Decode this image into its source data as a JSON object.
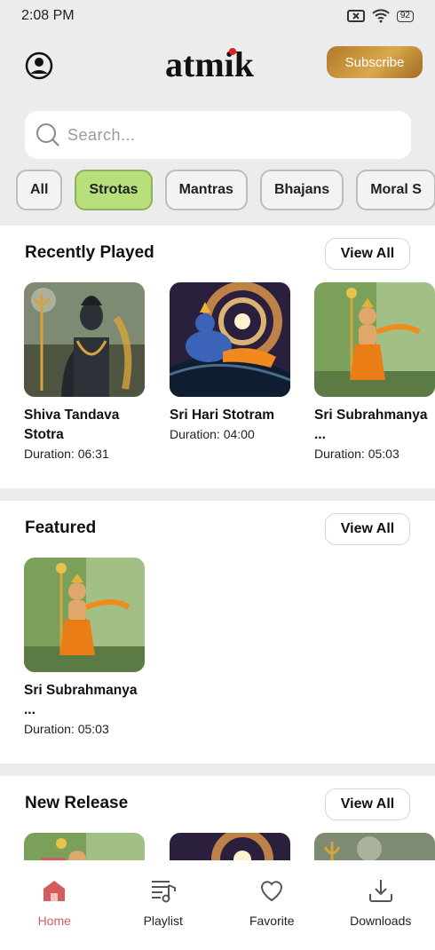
{
  "status": {
    "time": "2:08 PM",
    "battery": "92"
  },
  "header": {
    "logo_text": "atmik",
    "subscribe_label": "Subscribe"
  },
  "search": {
    "placeholder": "Search..."
  },
  "chips": [
    "All",
    "Strotas",
    "Mantras",
    "Bhajans",
    "Moral S"
  ],
  "active_chip": "Strotas",
  "sections": {
    "recent": {
      "title": "Recently Played",
      "view_all": "View All",
      "items": [
        {
          "title": "Shiva Tandava Stotra",
          "duration": "Duration: 06:31",
          "art": "shiva-icon"
        },
        {
          "title": "Sri Hari Stotram",
          "duration": "Duration: 04:00",
          "art": "vishnu-icon"
        },
        {
          "title": "Sri Subrahmanya ...",
          "duration": "Duration: 05:03",
          "art": "murugan-icon"
        }
      ]
    },
    "featured": {
      "title": "Featured",
      "view_all": "View All",
      "items": [
        {
          "title": "Sri Subrahmanya ...",
          "duration": "Duration: 05:03",
          "art": "murugan-icon"
        }
      ]
    },
    "new_release": {
      "title": "New Release",
      "view_all": "View All"
    }
  },
  "nav": {
    "items": [
      {
        "label": "Home",
        "icon": "home-icon"
      },
      {
        "label": "Playlist",
        "icon": "playlist-icon"
      },
      {
        "label": "Favorite",
        "icon": "heart-icon"
      },
      {
        "label": "Downloads",
        "icon": "download-icon"
      }
    ],
    "active": "Home"
  },
  "colors": {
    "accent": "#d45c5c",
    "chip_active": "#b7e07c",
    "subscribe": "#c08a32"
  }
}
